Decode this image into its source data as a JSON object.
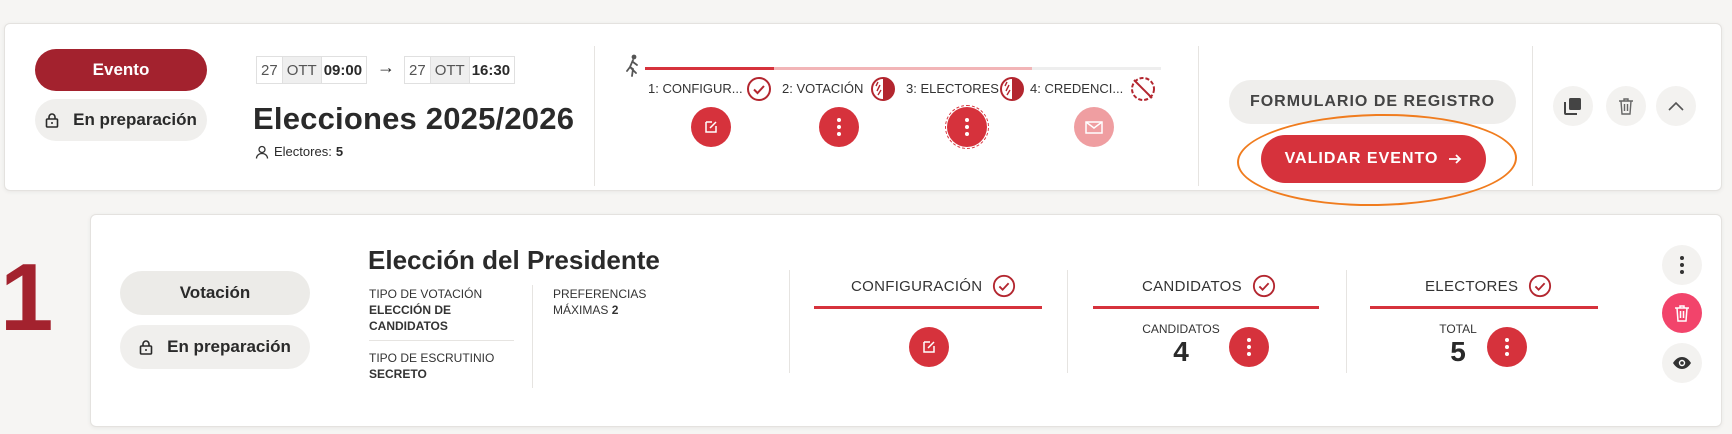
{
  "event": {
    "type_label": "Evento",
    "status_label": "En preparación",
    "start": {
      "day": "27",
      "month": "OTT",
      "time": "09:00"
    },
    "end": {
      "day": "27",
      "month": "OTT",
      "time": "16:30"
    },
    "arrow": "→",
    "title": "Elecciones 2025/2026",
    "voters_label": "Electores:",
    "voters_count": "5",
    "steps": [
      {
        "label": "1: CONFIGUR...",
        "status": "complete"
      },
      {
        "label": "2: VOTACIÓN",
        "status": "partial"
      },
      {
        "label": "3: ELECTORES",
        "status": "partial"
      },
      {
        "label": "4: CREDENCI...",
        "status": "disabled"
      }
    ],
    "progress_fraction": 0.75,
    "registration_button": "FORMULARIO DE REGISTRO",
    "validate_button": "VALIDAR EVENTO",
    "highlight_color": "#f07c1e"
  },
  "vote": {
    "index": "1",
    "type_label": "Votación",
    "status_label": "En preparación",
    "title": "Elección del Presidente",
    "voting_type_label": "TIPO DE VOTACIÓN",
    "voting_type_value": "ELECCIÓN DE CANDIDATOS",
    "scrutiny_label": "TIPO DE ESCRUTINIO",
    "scrutiny_value": "SECRETO",
    "preferences_label": "PREFERENCIAS MÁXIMAS",
    "preferences_value": "2",
    "sections": {
      "config": {
        "title": "CONFIGURACIÓN"
      },
      "candidates": {
        "title": "CANDIDATOS",
        "stat_label": "CANDIDATOS",
        "stat_value": "4"
      },
      "voters": {
        "title": "ELECTORES",
        "stat_label": "TOTAL",
        "stat_value": "5"
      }
    }
  },
  "colors": {
    "brand_dark": "#a3222e",
    "accent": "#d6323c",
    "accent_faded": "#ef9ea1",
    "delete_pink": "#f2446b"
  },
  "icons": [
    "lock-icon",
    "user-icon",
    "walking-person-icon",
    "check-circle-icon",
    "half-circle-icon",
    "blocked-icon",
    "edit-icon",
    "kebab-icon",
    "envelope-icon",
    "copy-icon",
    "trash-icon",
    "chevron-up-icon",
    "eye-icon",
    "arrow-right-icon"
  ]
}
